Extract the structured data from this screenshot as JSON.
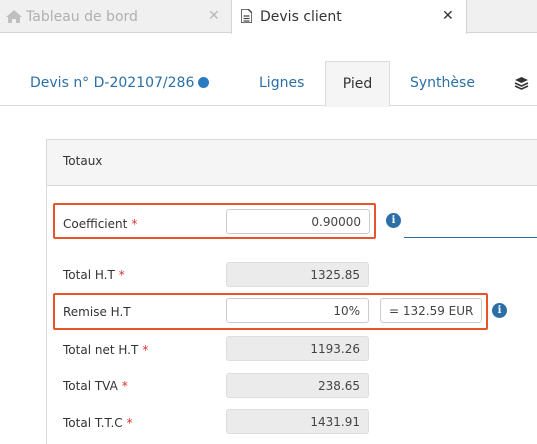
{
  "window_tabs": [
    {
      "label": "Tableau de bord",
      "icon": "home-icon",
      "active": false
    },
    {
      "label": "Devis client",
      "icon": "document-icon",
      "active": true
    }
  ],
  "subnav": {
    "devis": "Devis n° D-202107/286",
    "lignes": "Lignes",
    "pied": "Pied",
    "synthese": "Synthèse"
  },
  "panel": {
    "title": "Totaux",
    "coefficient": {
      "label": "Coefficient",
      "value": "0.90000"
    },
    "total_ht": {
      "label": "Total H.T",
      "value": "1325.85"
    },
    "remise_ht": {
      "label": "Remise H.T",
      "value": "10%",
      "eur": "= 132.59 EUR"
    },
    "total_net_ht": {
      "label": "Total net H.T",
      "value": "1193.26"
    },
    "total_tva": {
      "label": "Total TVA",
      "value": "238.65"
    },
    "total_ttc": {
      "label": "Total T.T.C",
      "value": "1431.91"
    },
    "required_mark": "*"
  },
  "colors": {
    "accent": "#2a6fa8",
    "highlight": "#e8542a",
    "required": "#d9302c"
  }
}
